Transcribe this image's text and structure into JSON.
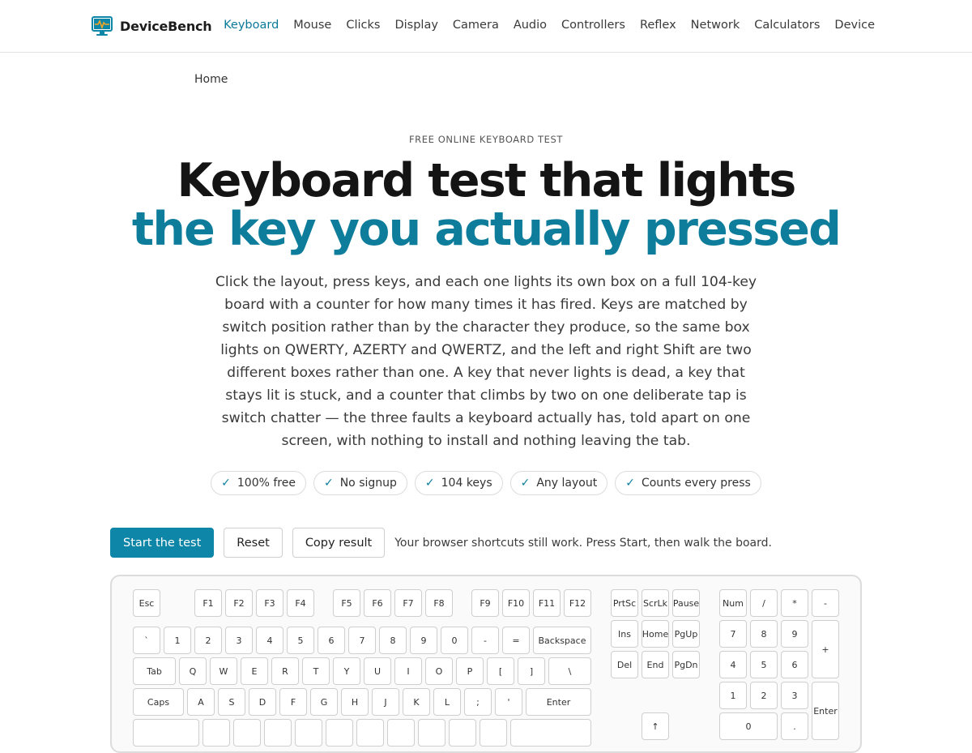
{
  "header": {
    "brand": "DeviceBench",
    "nav": [
      "Keyboard",
      "Mouse",
      "Clicks",
      "Display",
      "Camera",
      "Audio",
      "Controllers",
      "Reflex",
      "Network",
      "Calculators",
      "Device"
    ],
    "active_nav": "Keyboard"
  },
  "breadcrumb": "Home",
  "hero": {
    "eyebrow": "FREE ONLINE KEYBOARD TEST",
    "title_line1": "Keyboard test that lights",
    "title_line2": "the key you actually pressed",
    "lede": "Click the layout, press keys, and each one lights its own box on a full 104-key board with a counter for how many times it has fired. Keys are matched by switch position rather than by the character they produce, so the same box lights on QWERTY, AZERTY and QWERTZ, and the left and right Shift are two different boxes rather than one. A key that never lights is dead, a key that stays lit is stuck, and a counter that climbs by two on one deliberate tap is switch chatter — the three faults a keyboard actually has, told apart on one screen, with nothing to install and nothing leaving the tab."
  },
  "pills": [
    "100% free",
    "No signup",
    "104 keys",
    "Any layout",
    "Counts every press"
  ],
  "actions": {
    "start": "Start the test",
    "reset": "Reset",
    "copy": "Copy result",
    "hint": "Your browser shortcuts still work. Press Start, then walk the board."
  },
  "keyboard": {
    "rows": [
      [
        "Esc",
        "F1",
        "F2",
        "F3",
        "F4",
        "F5",
        "F6",
        "F7",
        "F8",
        "F9",
        "F10",
        "F11",
        "F12"
      ],
      [
        "`",
        "1",
        "2",
        "3",
        "4",
        "5",
        "6",
        "7",
        "8",
        "9",
        "0",
        "-",
        "=",
        "Backspace"
      ],
      [
        "Tab",
        "Q",
        "W",
        "E",
        "R",
        "T",
        "Y",
        "U",
        "I",
        "O",
        "P",
        "[",
        "]",
        "\\"
      ],
      [
        "Caps",
        "A",
        "S",
        "D",
        "F",
        "G",
        "H",
        "J",
        "K",
        "L",
        ";",
        "'",
        "Enter"
      ],
      [
        "",
        "",
        "",
        "",
        "",
        "",
        "",
        "",
        "",
        "",
        "",
        "",
        ""
      ]
    ],
    "nav_cluster": [
      [
        "PrtSc",
        "ScrLk",
        "Pause"
      ],
      [
        "Ins",
        "Home",
        "PgUp"
      ],
      [
        "Del",
        "End",
        "PgDn"
      ]
    ],
    "arrow_up": "↑",
    "numpad": [
      [
        "Num",
        "/",
        "*",
        "-"
      ],
      [
        "7",
        "8",
        "9",
        "+"
      ],
      [
        "4",
        "5",
        "6"
      ],
      [
        "1",
        "2",
        "3",
        "Enter"
      ],
      [
        "0",
        "."
      ]
    ]
  },
  "colors": {
    "accent": "#0e7d9b",
    "button": "#0e86a8"
  }
}
